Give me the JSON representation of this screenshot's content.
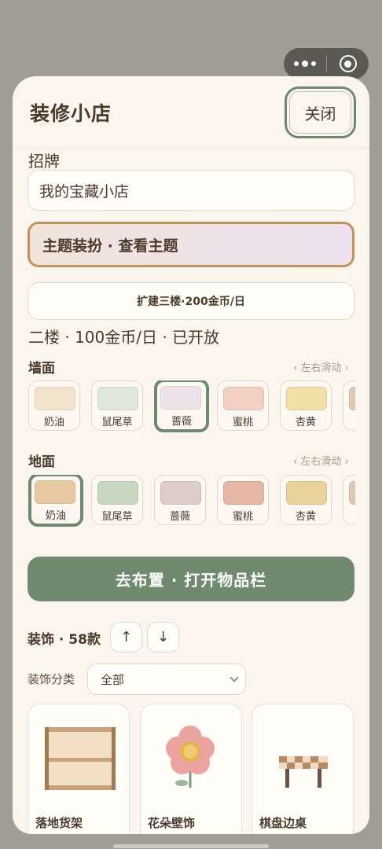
{
  "capsule": {
    "more_icon": "more-dots-icon",
    "close_icon": "target-circle-icon"
  },
  "header": {
    "title": "装修小店",
    "close_label": "关闭"
  },
  "signboard": {
    "label": "招牌",
    "value": "我的宝藏小店"
  },
  "theme_button": {
    "label": "主题装扮 · 查看主题"
  },
  "expand_button": {
    "label": "扩建三楼·200金币/日"
  },
  "floor_status": "二楼 · 100金币/日 · 已开放",
  "wall": {
    "title": "墙面",
    "hint": "‹ 左右滑动 ›",
    "selected": "蔷薇",
    "options": [
      {
        "name": "奶油",
        "color": "#f1e3cc"
      },
      {
        "name": "鼠尾草",
        "color": "#dfe7da"
      },
      {
        "name": "蔷薇",
        "color": "#efe3ea"
      },
      {
        "name": "蜜桃",
        "color": "#f4d0c3"
      },
      {
        "name": "杏黄",
        "color": "#f1e0a8"
      }
    ]
  },
  "floor": {
    "title": "地面",
    "hint": "‹ 左右滑动 ›",
    "selected": "奶油",
    "options": [
      {
        "name": "奶油",
        "color": "#e9c9a2"
      },
      {
        "name": "鼠尾草",
        "color": "#c8d7bf"
      },
      {
        "name": "蔷薇",
        "color": "#ddcdc6"
      },
      {
        "name": "蜜桃",
        "color": "#e5b7a4"
      },
      {
        "name": "杏黄",
        "color": "#e8d49b"
      }
    ]
  },
  "layout_button": {
    "label": "去布置 · 打开物品栏"
  },
  "decorations": {
    "count_label": "装饰 · 58款",
    "sort_up": "↑",
    "sort_down": "↓",
    "category_label": "装饰分类",
    "category_value": "全部",
    "items": [
      {
        "name": "落地货架",
        "icon": "shelf-icon"
      },
      {
        "name": "花朵壁饰",
        "icon": "flower-icon"
      },
      {
        "name": "棋盘边桌",
        "icon": "checker-table-icon"
      }
    ]
  },
  "colors": {
    "accent_green": "#6f8a6e",
    "theme_border": "#c0935e",
    "background": "#faf6ee"
  }
}
